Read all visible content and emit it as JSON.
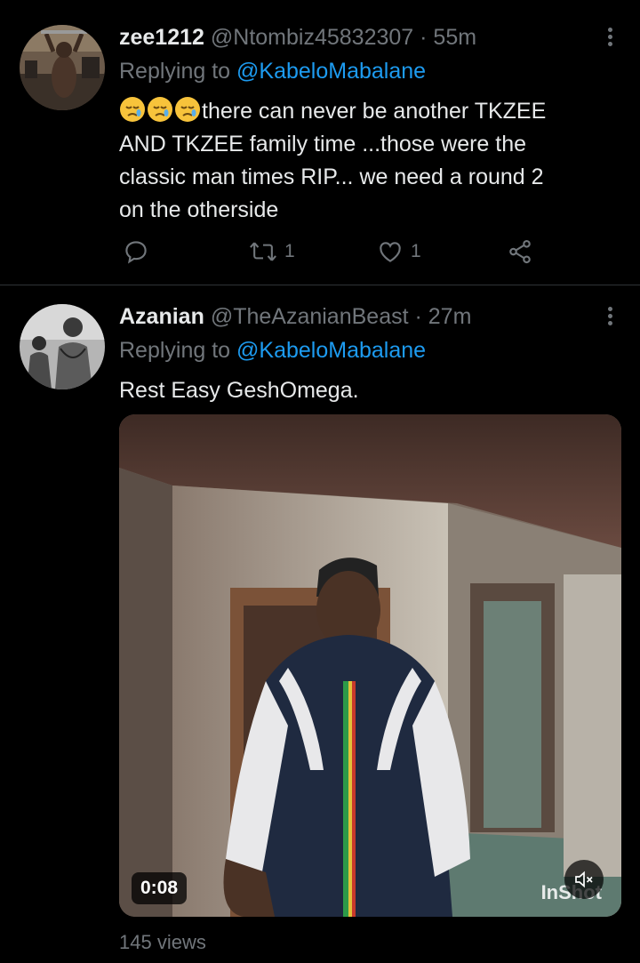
{
  "tweets": [
    {
      "name": "zee1212",
      "handle": "@Ntombiz45832307",
      "separator": "·",
      "time": "55m",
      "replying_prefix": "Replying to ",
      "replying_to": "@KabeloMabalane",
      "emoji_prefix": [
        "sad-face-emoji",
        "sad-face-emoji",
        "sad-face-emoji"
      ],
      "text_lines": [
        "there can never be another TKZEE",
        "AND TKZEE family time ...those were the",
        "classic man times RIP... we need a round 2",
        "on the otherside"
      ],
      "actions": {
        "reply_count": "",
        "retweet_count": "1",
        "like_count": "1"
      }
    },
    {
      "name": "Azanian",
      "handle": "@TheAzanianBeast",
      "separator": "·",
      "time": "27m",
      "replying_prefix": "Replying to ",
      "replying_to": "@KabeloMabalane",
      "text": "Rest Easy GeshOmega.",
      "media": {
        "duration": "0:08",
        "watermark": "InShot",
        "views": "145 views"
      }
    }
  ],
  "colors": {
    "background": "#000000",
    "text_primary": "#e7e9ea",
    "text_secondary": "#71767b",
    "link": "#1d9bf0",
    "divider": "#2f3336"
  }
}
